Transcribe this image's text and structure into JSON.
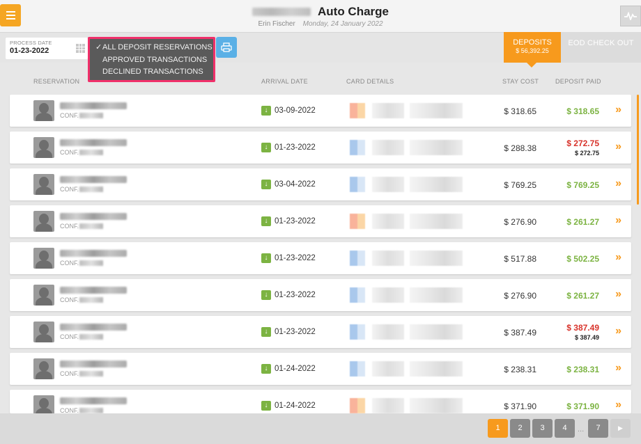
{
  "header": {
    "title": "Auto Charge",
    "user": "Erin Fischer",
    "date": "Monday, 24 January 2022",
    "menu_icon": "hamburger-icon",
    "right_icon": "pulse-icon"
  },
  "toolbar": {
    "process_date_label": "PROCESS DATE",
    "process_date_value": "01-23-2022",
    "filter_options": [
      {
        "label": "ALL DEPOSIT RESERVATIONS",
        "selected": true
      },
      {
        "label": "APPROVED TRANSACTIONS",
        "selected": false
      },
      {
        "label": "DECLINED TRANSACTIONS",
        "selected": false
      }
    ],
    "check_mark": "✓",
    "tabs": {
      "deposits_label": "DEPOSITS",
      "deposits_amount": "$ 56,392.25",
      "eod_label": "EOD CHECK OUT"
    }
  },
  "columns": {
    "reservation": "RESERVATION",
    "arrival_date": "ARRIVAL DATE",
    "card_details": "CARD DETAILS",
    "stay_cost": "STAY COST",
    "deposit_paid": "DEPOSIT PAID"
  },
  "rows": [
    {
      "conf": "CONF.",
      "arrival": "03-09-2022",
      "stay": "$ 318.65",
      "paid": "$ 318.65",
      "paid_sub": "",
      "declined": false,
      "card": "orange"
    },
    {
      "conf": "CONF.",
      "arrival": "01-23-2022",
      "stay": "$ 288.38",
      "paid": "$ 272.75",
      "paid_sub": "$ 272.75",
      "declined": true,
      "card": "blue"
    },
    {
      "conf": "CONF.",
      "arrival": "03-04-2022",
      "stay": "$ 769.25",
      "paid": "$ 769.25",
      "paid_sub": "",
      "declined": false,
      "card": "blue"
    },
    {
      "conf": "CONF.",
      "arrival": "01-23-2022",
      "stay": "$ 276.90",
      "paid": "$ 261.27",
      "paid_sub": "",
      "declined": false,
      "card": "orange"
    },
    {
      "conf": "CONF.",
      "arrival": "01-23-2022",
      "stay": "$ 517.88",
      "paid": "$ 502.25",
      "paid_sub": "",
      "declined": false,
      "card": "blue"
    },
    {
      "conf": "CONF.",
      "arrival": "01-23-2022",
      "stay": "$ 276.90",
      "paid": "$ 261.27",
      "paid_sub": "",
      "declined": false,
      "card": "blue"
    },
    {
      "conf": "CONF.",
      "arrival": "01-23-2022",
      "stay": "$ 387.49",
      "paid": "$ 387.49",
      "paid_sub": "$ 387.49",
      "declined": true,
      "card": "blue"
    },
    {
      "conf": "CONF.",
      "arrival": "01-24-2022",
      "stay": "$ 238.31",
      "paid": "$ 238.31",
      "paid_sub": "",
      "declined": false,
      "card": "blue"
    },
    {
      "conf": "CONF.",
      "arrival": "01-24-2022",
      "stay": "$ 371.90",
      "paid": "$ 371.90",
      "paid_sub": "",
      "declined": false,
      "card": "orange"
    }
  ],
  "pagination": {
    "pages": [
      "1",
      "2",
      "3",
      "4"
    ],
    "ellipsis": "...",
    "last": "7",
    "active": "1",
    "next_icon": "▶"
  },
  "colors": {
    "accent": "#f79a1d",
    "approved": "#7cb342",
    "declined": "#d8332b",
    "dropdown_border": "#f0306a",
    "filter_button": "#5ab0e6"
  }
}
